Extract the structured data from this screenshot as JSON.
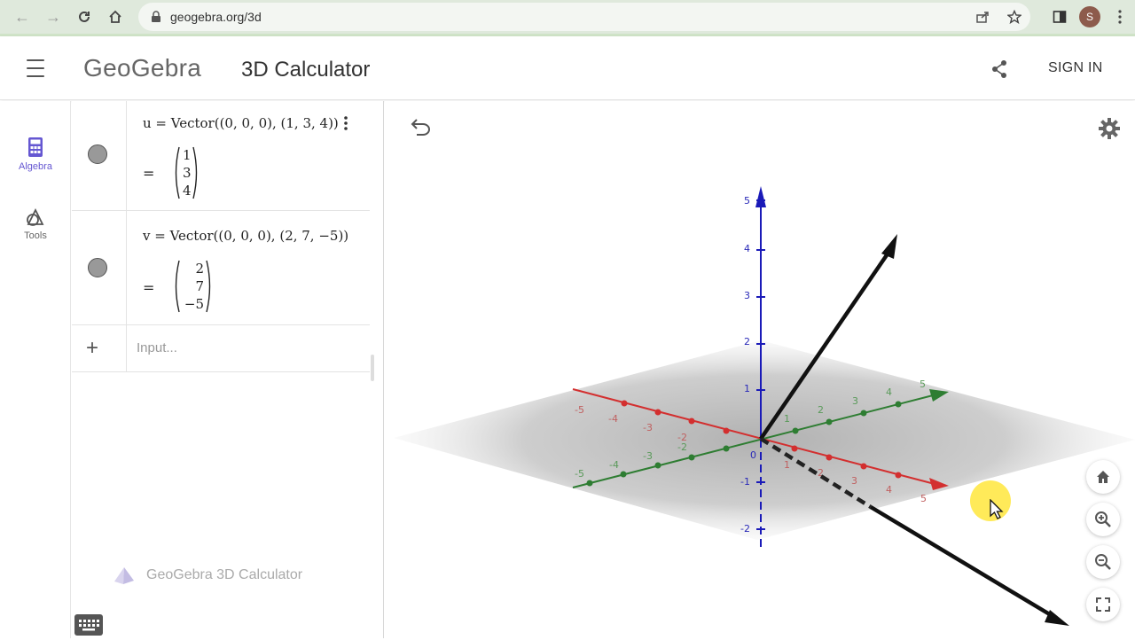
{
  "browser": {
    "url": "geogebra.org/3d",
    "profile_initial": "S"
  },
  "header": {
    "logo": "GeoGebra",
    "title": "3D Calculator",
    "signin_label": "SIGN IN"
  },
  "sidebar": {
    "items": [
      {
        "label": "Algebra",
        "active": true,
        "icon": "calculator-icon"
      },
      {
        "label": "Tools",
        "active": false,
        "icon": "tools-shapes-icon"
      }
    ]
  },
  "algebra": {
    "rows": [
      {
        "definition": "u = Vector((0, 0, 0), (1, 3, 4))",
        "equals": "=",
        "values": [
          "1",
          "3",
          "4"
        ]
      },
      {
        "definition": "v = Vector((0, 0, 0), (2, 7, −5))",
        "equals": "=",
        "values": [
          "2",
          "7",
          "−5"
        ]
      }
    ],
    "input_placeholder": "Input...",
    "watermark": "GeoGebra 3D Calculator"
  },
  "graphics": {
    "axis_colors": {
      "x": "#d32f2f",
      "y": "#2e7d32",
      "z": "#1a1ab8"
    },
    "x_ticks": [
      "-5",
      "-4",
      "-3",
      "-2",
      "1",
      "2",
      "3",
      "4",
      "5"
    ],
    "y_ticks": [
      "-5",
      "-4",
      "-3",
      "-2",
      "1",
      "2",
      "3",
      "4",
      "5"
    ],
    "z_ticks": [
      "5",
      "4",
      "3",
      "2",
      "1",
      "0",
      "-1",
      "-2"
    ]
  }
}
